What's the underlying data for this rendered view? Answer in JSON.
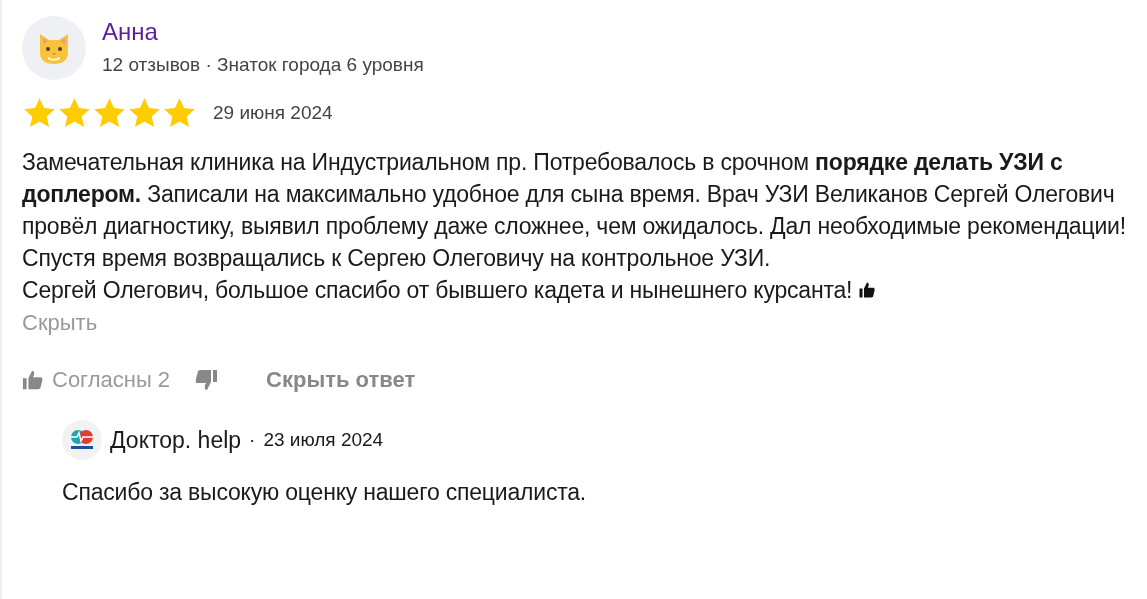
{
  "author": {
    "name": "Анна",
    "meta": "12 отзывов · Знаток города 6 уровня"
  },
  "review": {
    "stars": 5,
    "date": "29 июня 2024",
    "paragraphs": [
      "Замечательная клиника на Индустриальном пр. Потребовалось в срочном **порядке делать УЗИ с доплером.** Записали на максимально удобное для сына время. Врач УЗИ Великанов Сергей Олегович провёл диагностику, выявил проблему даже сложнее, чем ожидалось. Дал необходимые рекомендации! Спустя время возвращались к Сергею Олеговичу на контрольное УЗИ.",
      "Сергей Олегович, большое спасибо от бывшего кадета и нынешнего курсанта!"
    ],
    "collapse_link": "Скрыть"
  },
  "actions": {
    "like_label": "Согласны 2",
    "hide_reply": "Скрыть ответ"
  },
  "reply": {
    "author": "Доктор. help",
    "separator": "·",
    "date": "23 июля 2024",
    "text": "Спасибо за высокую оценку нашего специалиста."
  }
}
